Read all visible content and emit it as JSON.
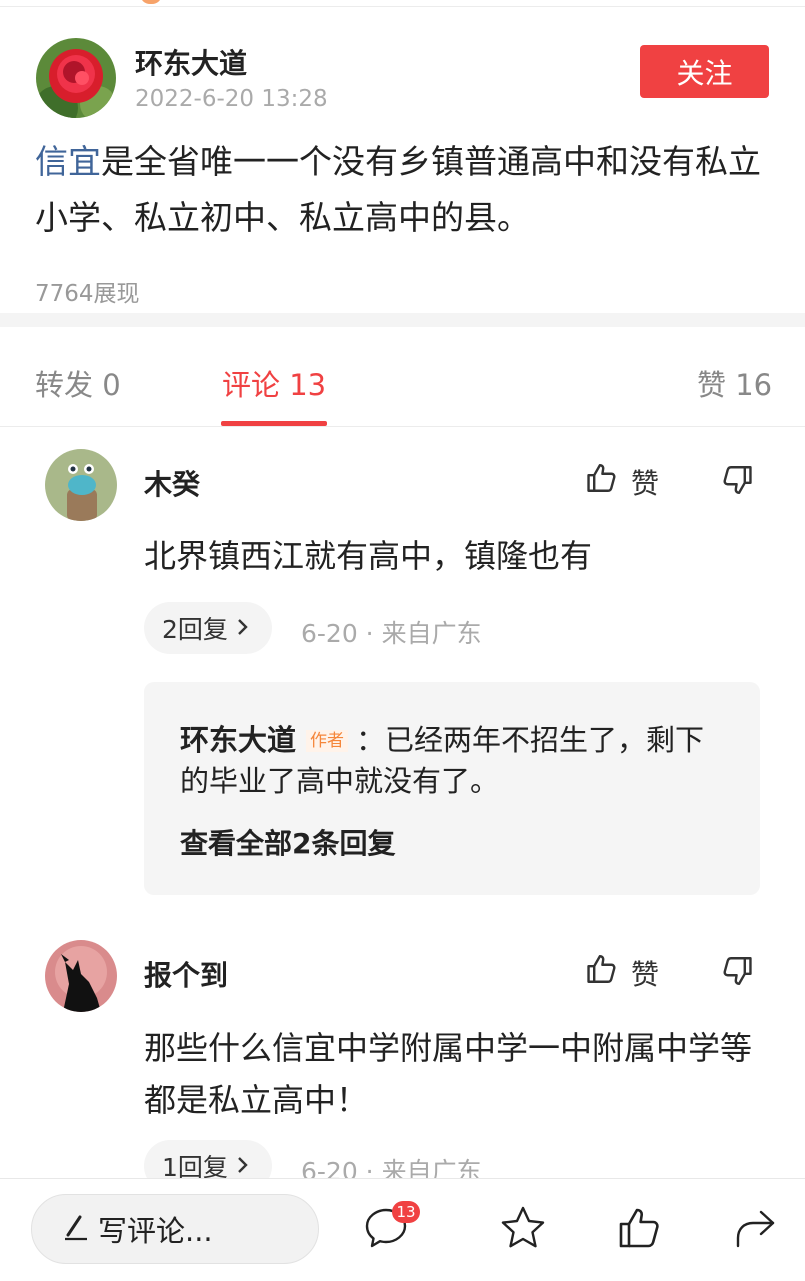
{
  "post": {
    "author": "环东大道",
    "time": "2022-6-20 13:28",
    "follow_label": "关注",
    "text_link": "信宜",
    "text_rest": "是全省唯一一个没有乡镇普通高中和没有私立小学、私立初中、私立高中的县。",
    "views": "7764展现"
  },
  "tabs": [
    {
      "label": "转发 0",
      "active": false
    },
    {
      "label": "评论 13",
      "active": true
    },
    {
      "label": "赞 16",
      "active": false
    }
  ],
  "comments": [
    {
      "name": "木癸",
      "like_label": "赞",
      "text": "北界镇西江就有高中，镇隆也有",
      "reply_count": "2回复",
      "meta": "6-20 · 来自广东",
      "reply": {
        "name": "环东大道",
        "tag": "作者",
        "text": "：已经两年不招生了，剩下的毕业了高中就没有了。",
        "view_all": "查看全部2条回复"
      }
    },
    {
      "name": "报个到",
      "like_label": "赞",
      "text": "那些什么信宜中学附属中学一中附属中学等都是私立高中！",
      "reply_count": "1回复",
      "meta": "6-20 · 来自广东"
    }
  ],
  "bottom": {
    "write_placeholder": "写评论...",
    "comment_badge": "13"
  },
  "icons": [
    "thumbs-up-icon",
    "thumbs-down-icon",
    "chevron-right-icon",
    "pen-icon",
    "comment-icon",
    "star-icon",
    "share-icon"
  ],
  "colors": {
    "accent": "#f04142",
    "link": "#406599",
    "author_tag": "#f5863a"
  }
}
